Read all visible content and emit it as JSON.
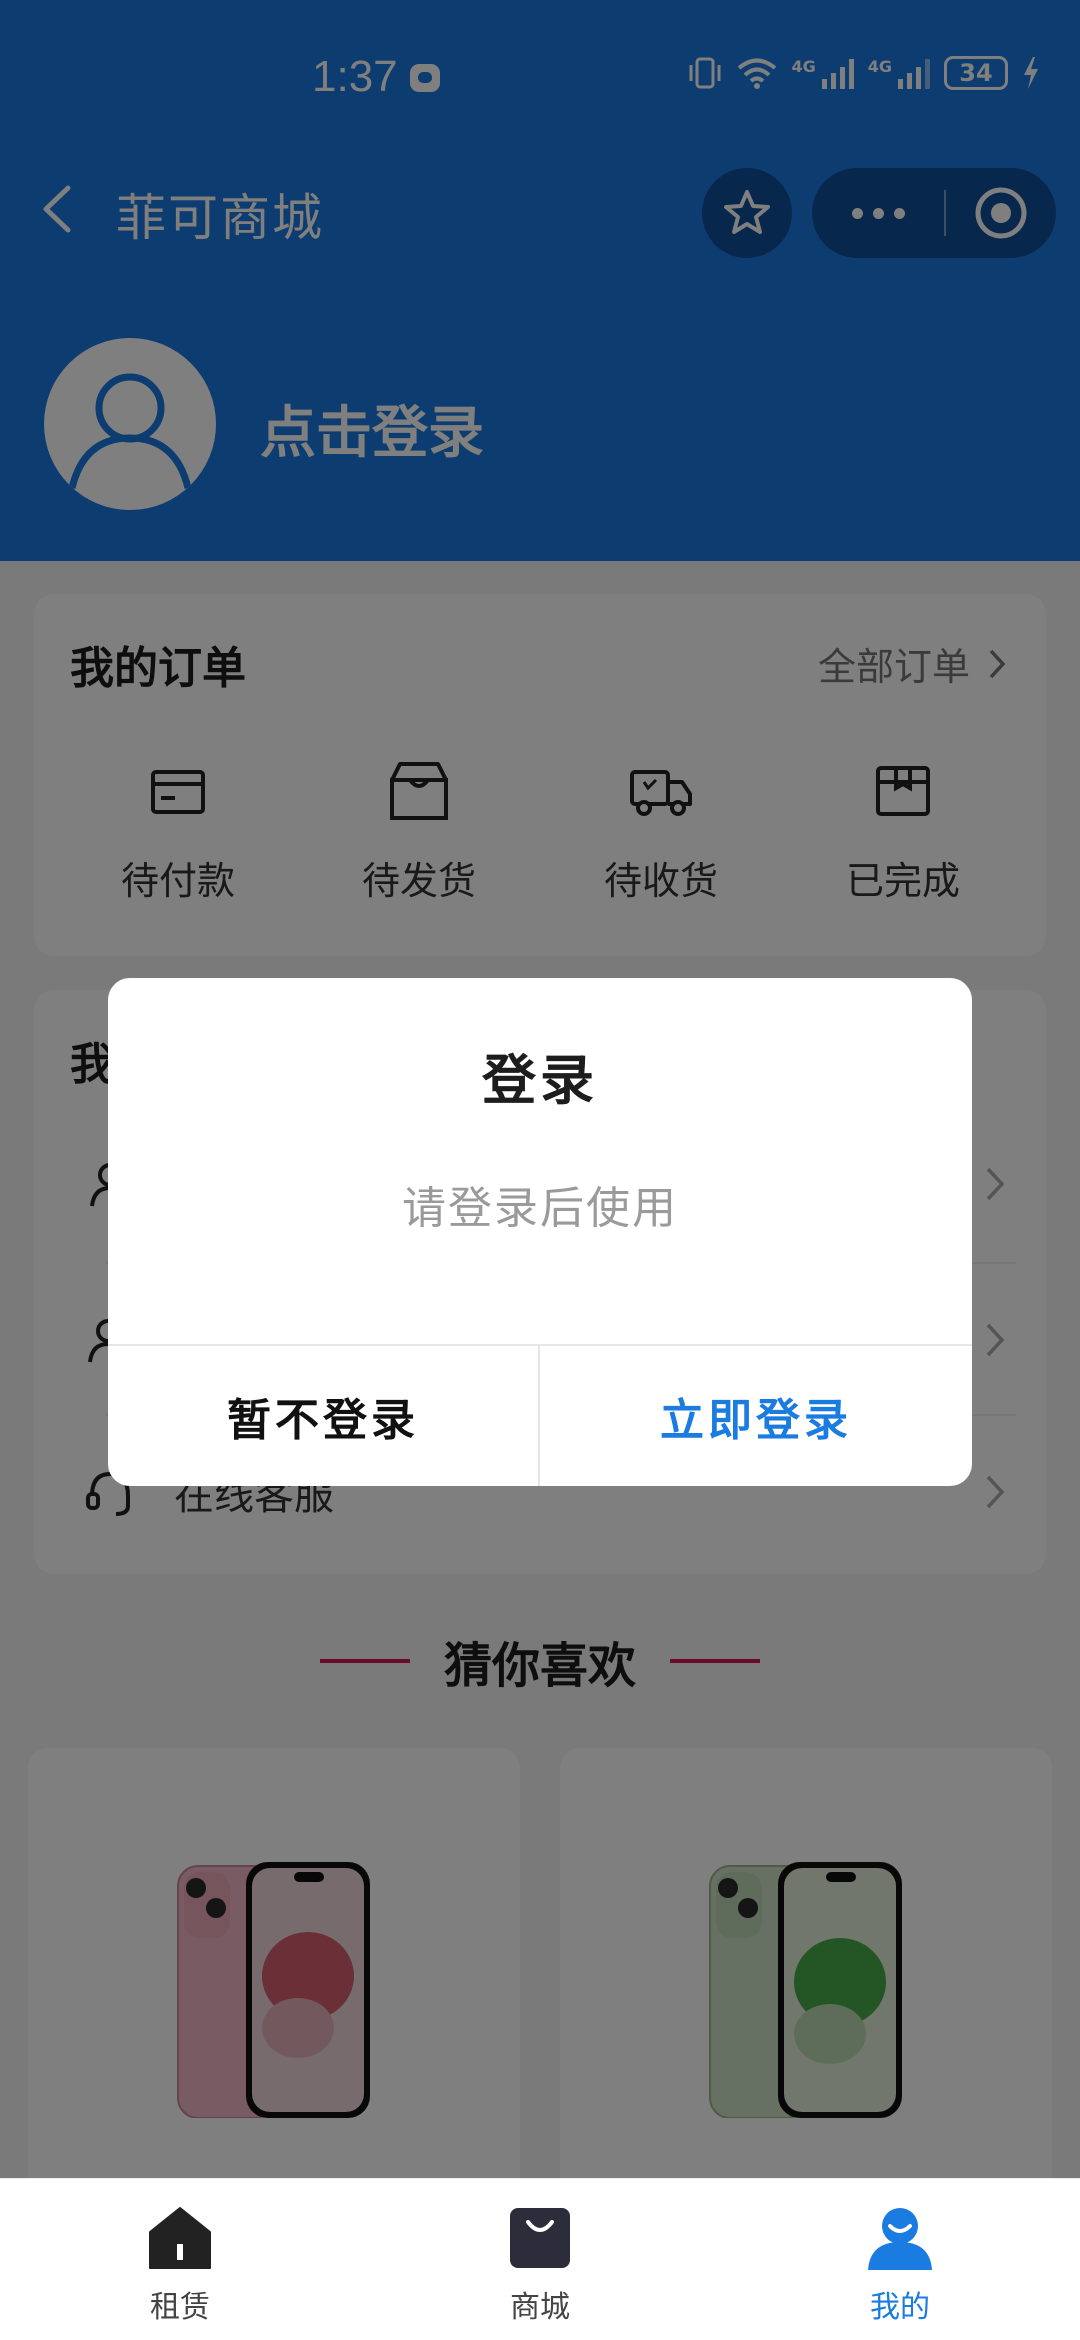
{
  "status_bar": {
    "time": "1:37",
    "network_1": "4G",
    "network_2": "4G",
    "battery": "34"
  },
  "nav": {
    "title": "菲可商城"
  },
  "header": {
    "login_prompt": "点击登录"
  },
  "orders": {
    "title": "我的订单",
    "all_link": "全部订单",
    "items": [
      {
        "label": "待付款",
        "icon": "wallet-icon"
      },
      {
        "label": "待发货",
        "icon": "box-icon"
      },
      {
        "label": "待收货",
        "icon": "truck-icon"
      },
      {
        "label": "已完成",
        "icon": "package-done-icon"
      }
    ]
  },
  "tools": {
    "title_visible": "我",
    "rows": [
      {
        "label": "",
        "icon": "user-icon"
      },
      {
        "label": "",
        "icon": "user-edit-icon"
      },
      {
        "label": "在线客服",
        "icon": "headset-icon"
      }
    ]
  },
  "recommend": {
    "title": "猜你喜欢"
  },
  "products": [
    {
      "color": "#f2b8c6",
      "accent": "#d2495d"
    },
    {
      "color": "#cfe3c7",
      "accent": "#39a33a"
    }
  ],
  "dialog": {
    "title": "登录",
    "message": "请登录后使用",
    "cancel_label": "暂不登录",
    "confirm_label": "立即登录"
  },
  "tabbar": {
    "items": [
      {
        "label": "租赁",
        "icon": "home-icon"
      },
      {
        "label": "商城",
        "icon": "shopping-bag-icon"
      },
      {
        "label": "我的",
        "icon": "profile-icon",
        "active": true
      }
    ]
  },
  "colors": {
    "brand": "#1a7be0",
    "accent_line": "#d6155a"
  }
}
